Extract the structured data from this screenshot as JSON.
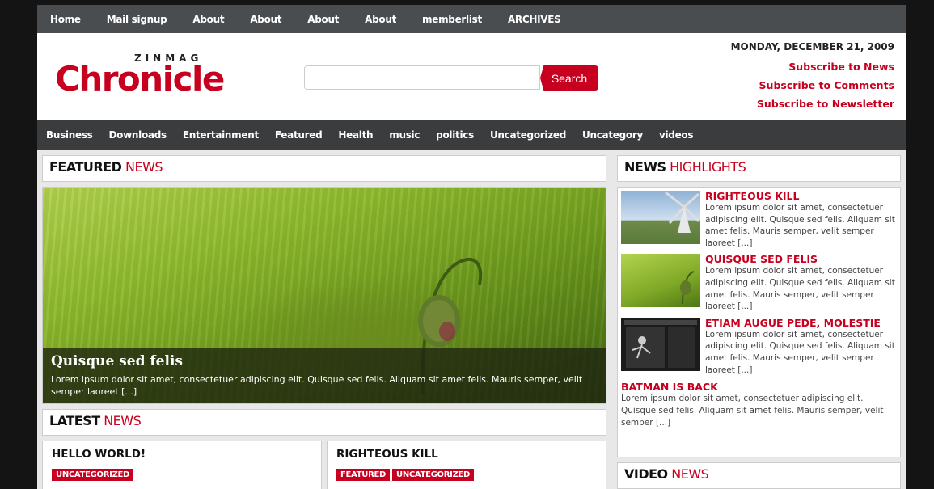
{
  "topnav": [
    "Home",
    "Mail signup",
    "About",
    "About",
    "About",
    "About",
    "memberlist",
    "ARCHIVES"
  ],
  "logo": {
    "small": "ZINMAG",
    "main": "Chronicle"
  },
  "search": {
    "button": "Search",
    "placeholder": ""
  },
  "header_right": {
    "date": "MONDAY, DECEMBER 21, 2009",
    "links": [
      "Subscribe to News",
      "Subscribe to Comments",
      "Subscribe to Newsletter"
    ]
  },
  "catnav": [
    "Business",
    "Downloads",
    "Entertainment",
    "Featured",
    "Health",
    "music",
    "politics",
    "Uncategorized",
    "Uncategory",
    "videos"
  ],
  "featured": {
    "head_bold": "FEATURED",
    "head_rest": " NEWS",
    "caption_title": "Quisque sed felis",
    "caption_text": "Lorem ipsum dolor sit amet, consectetuer adipiscing elit. Quisque sed felis. Aliquam sit amet felis. Mauris semper, velit semper laoreet [...]"
  },
  "latest": {
    "head_bold": "LATEST",
    "head_rest": " NEWS",
    "items": [
      {
        "title": "HELLO WORLD!",
        "tags": [
          "UNCATEGORIZED"
        ]
      },
      {
        "title": "RIGHTEOUS KILL",
        "tags": [
          "FEATURED",
          "UNCATEGORIZED"
        ]
      }
    ]
  },
  "highlights": {
    "head_bold": "NEWS",
    "head_rest": " HIGHLIGHTS",
    "items": [
      {
        "title": "RIGHTEOUS KILL",
        "text": "Lorem ipsum dolor sit amet, consectetuer adipiscing elit. Quisque sed felis. Aliquam sit amet felis. Mauris semper, velit semper laoreet [...]"
      },
      {
        "title": "QUISQUE SED FELIS",
        "text": "Lorem ipsum dolor sit amet, consectetuer adipiscing elit. Quisque sed felis. Aliquam sit amet felis. Mauris semper, velit semper laoreet [...]"
      },
      {
        "title": "ETIAM AUGUE PEDE, MOLESTIE",
        "text": "Lorem ipsum dolor sit amet, consectetuer adipiscing elit. Quisque sed felis. Aliquam sit amet felis. Mauris semper, velit semper laoreet [...]"
      },
      {
        "title": "BATMAN IS BACK",
        "text": "Lorem ipsum dolor sit amet, consectetuer adipiscing elit. Quisque sed felis. Aliquam sit amet felis. Mauris semper, velit semper [...]"
      }
    ]
  },
  "video": {
    "head_bold": "VIDEO",
    "head_rest": " NEWS"
  },
  "colors": {
    "accent": "#c8001f",
    "topnav": "#4a4d50",
    "catnav": "#3a3c3e"
  }
}
